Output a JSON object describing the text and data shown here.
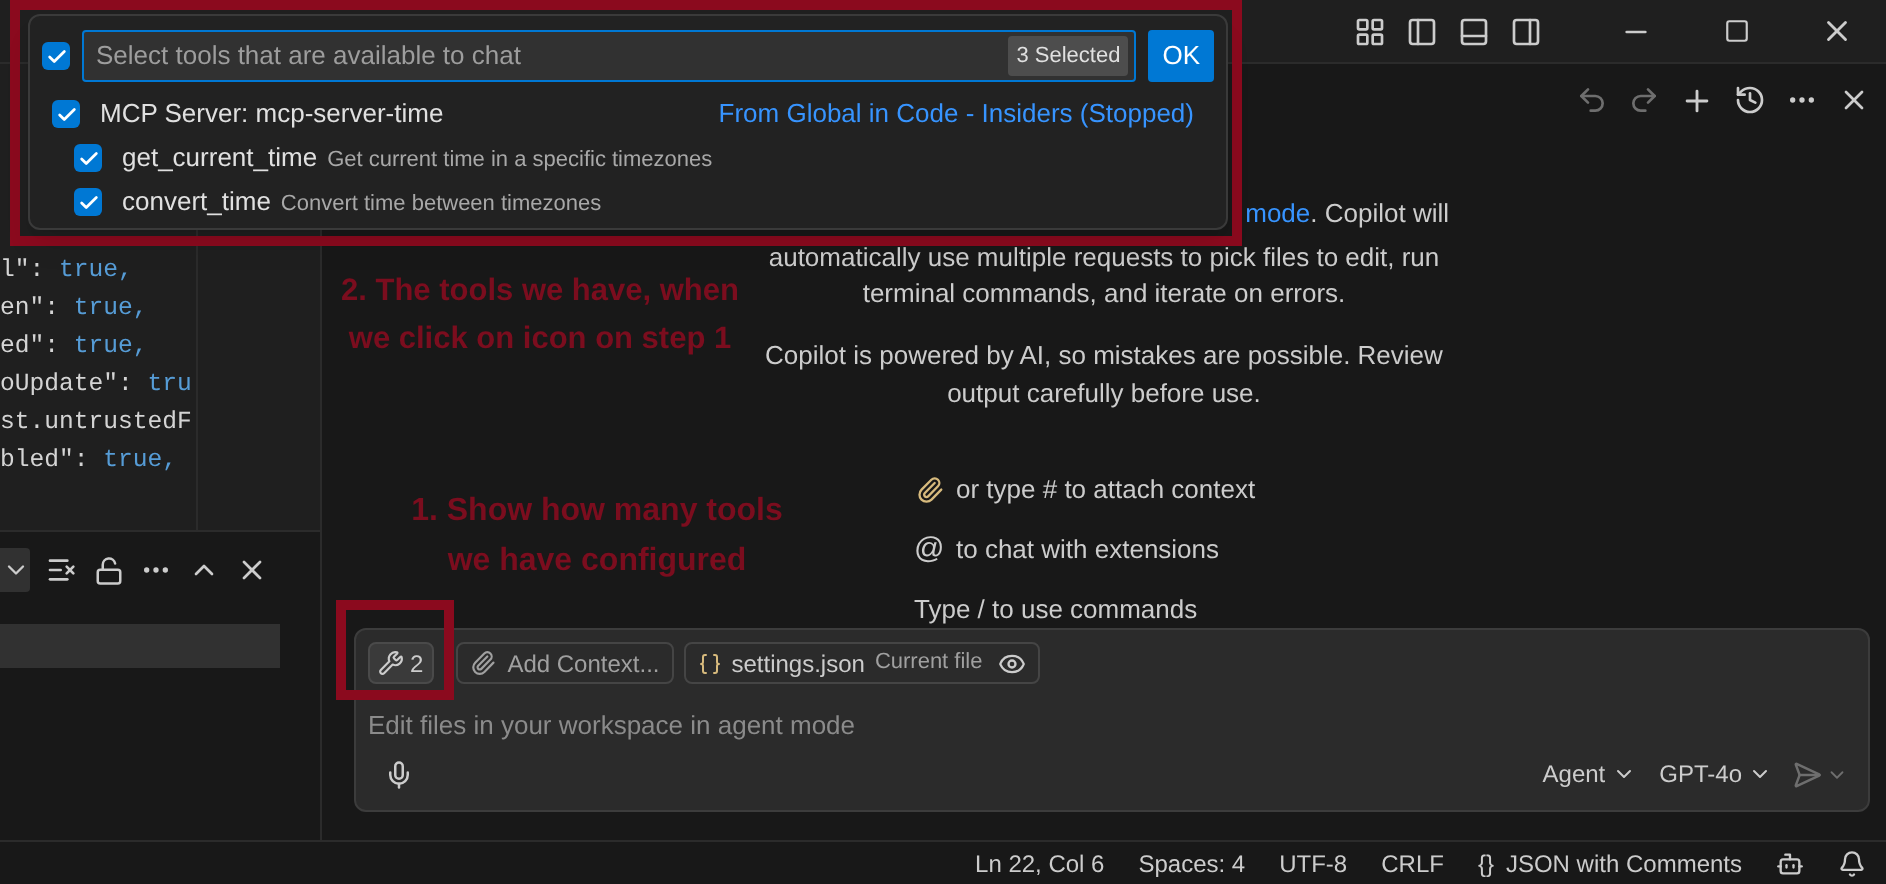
{
  "quick_pick": {
    "all_checked": true,
    "placeholder": "Select tools that are available to chat",
    "count_badge": "3 Selected",
    "ok_button": "OK",
    "items": [
      {
        "label": "MCP Server: mcp-server-time",
        "detail": "From Global in Code - Insiders (Stopped)",
        "checked": true,
        "children": [
          {
            "label": "get_current_time",
            "description": "Get current time in a specific timezones",
            "checked": true
          },
          {
            "label": "convert_time",
            "description": "Convert time between timezones",
            "checked": true
          }
        ]
      }
    ]
  },
  "editor": {
    "code_lines": [
      {
        "text": "l\": ",
        "value": "true,"
      },
      {
        "text": "en\": ",
        "value": "true,"
      },
      {
        "text": "ed\": ",
        "value": "true,"
      },
      {
        "text": "oUpdate\": ",
        "value": "tru"
      },
      {
        "text": "st.untrustedF"
      },
      {
        "text": "bled\": ",
        "value": "true,"
      }
    ]
  },
  "chat": {
    "intro_link": "mode",
    "intro_after_link": ". Copilot will",
    "intro_text": "automatically use multiple requests to pick files to edit, run terminal commands, and iterate on errors.",
    "disclaimer": "Copilot is powered by AI, so mistakes are possible. Review output carefully before use.",
    "hints": [
      {
        "kind": "attach",
        "text": "or type # to attach context"
      },
      {
        "kind": "mention",
        "glyph": "@",
        "text": "to chat with extensions"
      },
      {
        "kind": "plain",
        "text": "Type / to use commands"
      }
    ],
    "input": {
      "tools_count": "2",
      "add_context": "Add Context...",
      "file_name": "settings.json",
      "file_note": "Current file",
      "placeholder": "Edit files in your workspace in agent mode",
      "mode": "Agent",
      "model": "GPT-4o"
    }
  },
  "status_bar": [
    {
      "kind": "text",
      "text": "Ln 22, Col 6"
    },
    {
      "kind": "text",
      "text": "Spaces: 4"
    },
    {
      "kind": "text",
      "text": "UTF-8"
    },
    {
      "kind": "text",
      "text": "CRLF"
    },
    {
      "kind": "language",
      "glyph": "{}",
      "text": "JSON with Comments"
    }
  ],
  "annotations": [
    {
      "text": "2. The tools we have, when we click on icon on step 1"
    },
    {
      "text": "1. Show how many tools we have configured"
    }
  ]
}
